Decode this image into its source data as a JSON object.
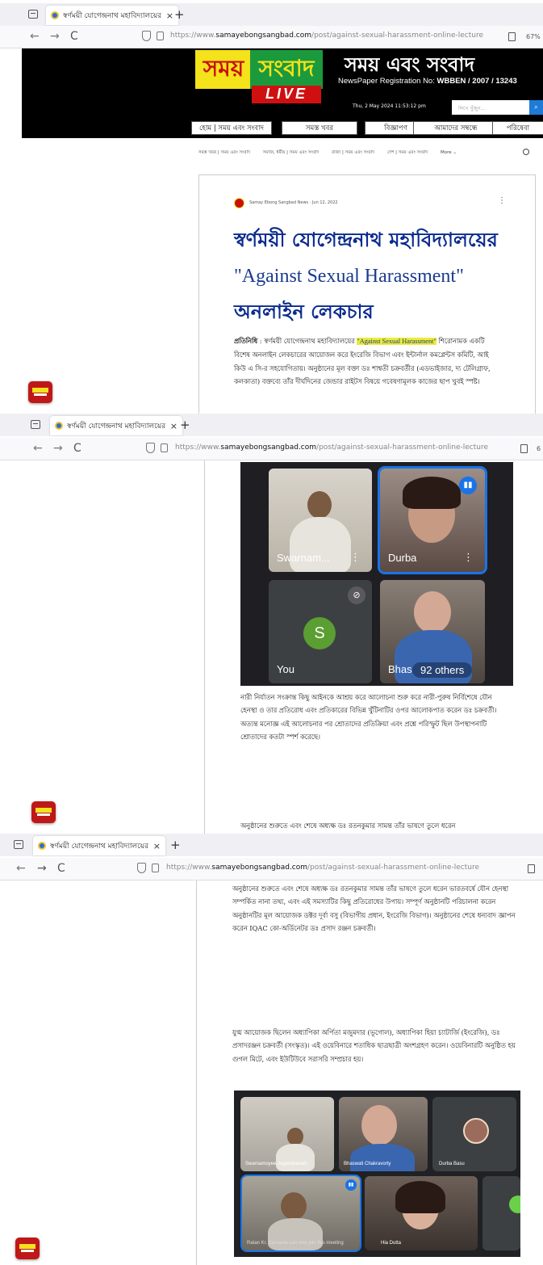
{
  "browser": {
    "tab_title": "স্বর্ণময়ী যোগেন্দ্রনাথ মহাবিদ্যালয়ের \"A",
    "tab_close": "×",
    "new_tab": "+",
    "back": "←",
    "forward": "→",
    "reload": "C",
    "url_prefix": "https://www.",
    "url_domain": "samayebongsangbad.com",
    "url_path": "/post/against-sexual-harassment-online-lecture",
    "zoom": "67%",
    "zoom_cut": "6"
  },
  "site": {
    "logo_part1": "সময়",
    "logo_part2": "সংবাদ",
    "logo_live": "LIVE",
    "title": "সময় এবং সংবাদ",
    "reg_label": "NewsPaper Registration No: ",
    "reg_number": "WBBEN / 2007 / 13243",
    "datetime": "Thu, 2 May 2024 11:53:12 pm",
    "search_placeholder": "লিখে খুঁজুন...",
    "search_icon": "search-icon",
    "menu": [
      "হোম | সময় এবং সংবাদ",
      "সমস্ত খবর",
      "বিজ্ঞাপণ",
      "আমাদের সম্বন্ধে",
      "পরিষেবা"
    ]
  },
  "categories": [
    "সমস্ত খবর | সময় এবং সংবাদ",
    "সমাজ, ধর্মীয় | সময় এবং সংবাদ",
    "রাজ্য | সময় এবং সংবাদ",
    "দেশ | সময় এবং সংবাদ",
    "More ⌄"
  ],
  "post": {
    "author": "Samay Ebong Sangbad News",
    "date": "Jun 12, 2022",
    "more": "⋮",
    "title_bn1": "স্বর্ণময়ী যোগেন্দ্রনাথ মহাবিদ্যালয়ের",
    "title_en": "\"Against Sexual Harassment\"",
    "title_bn2": " অনলাইন লেকচার",
    "para1_label": "প্রতিনিধি",
    "para1_a": " : স্বর্ণময়ী যোগেন্দ্রনাথ মহাবিদ্যালয়ের ",
    "para1_highlight": "\"Against Sexual Harassment\"",
    "para1_b": " শিরোনামক একটি বিশেষ অনলাইন লেকচারের আয়োজন করে ইংরেজি বিভাগ এবং ইন্টার্নাল কমপ্লেন্টস কমিটি, আই কিউ এ সি-র সহযোগিতায়। অনুষ্ঠানের মূল বক্তা ডঃ শাশ্বতী চক্রবর্তীর (এডভাইজার, দ্য টেলিগ্রাফ, কলকাতা) বক্তব্যে তাঁর দীর্ঘদিনের জেন্ডার রাইটস বিষয়ে গবেষণামূলক কাজের ছাপ খুবই স্পষ্ট।",
    "para2": "নারী নির্যাতন সংক্রান্ত কিছু আইনকে আশ্রয় করে আলোচনা শুরু করে নারী-পুরুষ নির্বিশেষে যৌন হেনস্থা ও তার প্রতিরোধ এবং প্রতিকারের বিভিন্ন খুঁটিনাটির ওপর আলোকপাত করেন ডঃ চক্রবর্তী। অত্যন্ত মনোজ্ঞ এই আলোচনার পর শ্রোতাদের প্রতিক্রিয়া এবং প্রশ্নে পরিস্ফুট ছিল উপস্থাপনাটি শ্রোতাদের কতটা স্পর্শ করেছে।",
    "para3_first": "অনুষ্ঠানের শুরুতে এবং শেষে অধ্যক্ষ ডঃ রতনকুমার সামন্ত তাঁর ভাষণে তুলে ধরেন",
    "para3": "অনুষ্ঠানের শুরুতে এবং শেষে অধ্যক্ষ ডঃ রতনকুমার সামন্ত তাঁর ভাষণে তুলে ধরেন ভারতবর্ষে যৌন হেনস্থা সম্পর্কিত নানা তথ্য, এবং এই সমস্যাটির কিছু প্রতিরোধের উপায়। সম্পূর্ণ অনুষ্ঠানটি পরিচালনা করেন অনুষ্ঠানটির মূল আয়োজক ডক্টর দূর্বা বসু (বিভাগীয় প্রধান, ইংরেজি বিভাগ)। অনুষ্ঠানের শেষে ধন্যবাদ জ্ঞাপন করেন IQAC কো-অর্ডিনেটর ডঃ প্রসাদ রঞ্জন চক্রবর্তী।",
    "para4": "যুগ্ম আয়োজক ছিলেন অধ্যাপিকা অর্পিতা মজুমদার (ভূগোল), অধ্যাপিকা হিয়া চ্যাটার্জি (ইংরেজি), ডঃ প্রসাদরঞ্জন চক্রবর্তী (সংস্কৃত)। এই ওয়েবিনারে শতাধিক ছাত্রছাত্রী অংশগ্রহণ করেন। ওয়েবিনারটি অনুষ্ঠিত হয় গুগল মিটে, এবং ইউটিউবে সরাসরি সম্প্রচার হয়।"
  },
  "meeting1": {
    "tiles": [
      "Swarnam...",
      "Durba",
      "You",
      "Bhas"
    ],
    "you_initial": "S",
    "others": "92 others",
    "more": "⋮"
  },
  "meeting2": {
    "labels": [
      "Swarnamoyee Jogendranath",
      "Bhaswati Chakravorty",
      "Durba Basu",
      "Ratan Kr. Samanta can now join this meeting",
      "Hia Dutta"
    ]
  },
  "colors": {
    "title_blue": "#0b2b8f",
    "highlight": "#ecec3a",
    "header_bg": "#000000"
  }
}
